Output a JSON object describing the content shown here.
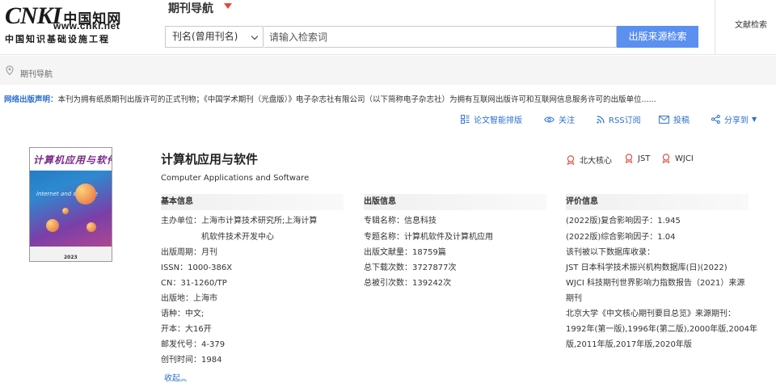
{
  "header": {
    "logo_cnki": "CNKI",
    "logo_cn": "中国知网",
    "logo_url": "www.cnki.net",
    "logo_slogan": "中国知识基础设施工程",
    "nav_title": "期刊导航",
    "search_select": "刊名(曾用刊名)",
    "search_placeholder": "请输入检索词",
    "search_button": "出版来源检索",
    "right_link": "文献检索"
  },
  "breadcrumb": {
    "text": "期刊导航"
  },
  "notice": {
    "label": "网络出版声明：",
    "text": "本刊为拥有纸质期刊出版许可的正式刊物；《中国学术期刊（光盘版）》电子杂志社有限公司（以下简称电子杂志社）为拥有互联网出版许可和互联网信息服务许可的出版单位......"
  },
  "toolbar": {
    "smart_layout": "论文智能排版",
    "follow": "关注",
    "rss": "RSS订阅",
    "submit": "投稿",
    "share": "分享到"
  },
  "cover": {
    "title": "计算机应用与软件",
    "year": "2023",
    "mid_text": "internet and software"
  },
  "journal": {
    "title": "计算机应用与软件",
    "subtitle": "Computer Applications and Software",
    "badges": [
      "北大核心",
      "JST",
      "WJCI"
    ]
  },
  "basic_info": {
    "heading": "基本信息",
    "sponsor_label": "主办单位：",
    "sponsor_line1": "上海市计算技术研究所;上海计算",
    "sponsor_line2": "机软件技术开发中心",
    "cycle_label": "出版周期：",
    "cycle": "月刊",
    "issn_label": "ISSN：",
    "issn": "1000-386X",
    "cn_label": "CN：",
    "cn": "31-1260/TP",
    "place_label": "出版地：",
    "place": "上海市",
    "lang_label": "语种：",
    "lang": "中文;",
    "format_label": "开本：",
    "format": "大16开",
    "postal_label": "邮发代号：",
    "postal": "4-379",
    "founded_label": "创刊时间：",
    "founded": "1984",
    "collapse": "收起"
  },
  "pub_info": {
    "heading": "出版信息",
    "series_label": "专辑名称：",
    "series": "信息科技",
    "topic_label": "专题名称：",
    "topic": "计算机软件及计算机应用",
    "count_label": "出版文献量：",
    "count": "18759篇",
    "downloads_label": "总下载次数：",
    "downloads": "3727877次",
    "citations_label": "总被引次数：",
    "citations": "139242次"
  },
  "eval_info": {
    "heading": "评价信息",
    "composite": "(2022版)复合影响因子：1.945",
    "comprehensive": "(2022版)综合影响因子：1.04",
    "indexed_by": "该刊被以下数据库收录：",
    "jst": "JST 日本科学技术振兴机构数据库(日)(2022)",
    "wjci_line1": "WJCI 科技期刊世界影响力指数报告（2021）来源",
    "wjci_line2": "期刊",
    "pku_heading": "北京大学《中文核心期刊要目总览》来源期刊：",
    "pku_line1": "1992年(第一版),1996年(第二版),2000年版,2004年",
    "pku_line2": "版,2011年版,2017年版,2020年版"
  }
}
